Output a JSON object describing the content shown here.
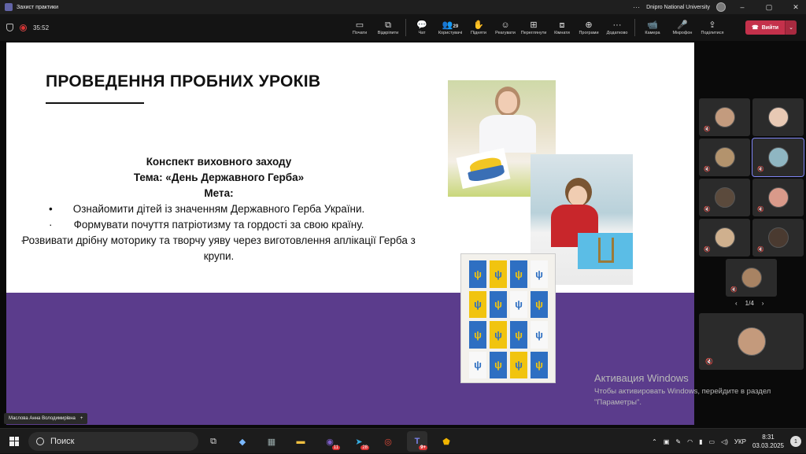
{
  "window": {
    "title": "Захист практики",
    "organization": "Dnipro National University",
    "more": "···",
    "minimize": "–",
    "maximize": "▢",
    "close": "✕"
  },
  "meeting": {
    "timer": "35:52",
    "participants_count": "29"
  },
  "toolbar": {
    "items": [
      {
        "label": "Почати",
        "icon": "▭"
      },
      {
        "label": "Відкріпити",
        "icon": "⧉"
      },
      {
        "label": "Чат",
        "icon": "💬"
      },
      {
        "label": "Користувачі",
        "icon": "👥"
      },
      {
        "label": "Підняти",
        "icon": "✋"
      },
      {
        "label": "Реагувати",
        "icon": "☺"
      },
      {
        "label": "Переглянути",
        "icon": "⊞"
      },
      {
        "label": "Кімнати",
        "icon": "⧈"
      },
      {
        "label": "Програми",
        "icon": "⊕"
      },
      {
        "label": "Додатково",
        "icon": "···"
      },
      {
        "label": "Камера",
        "icon": "📹"
      },
      {
        "label": "Мікрофон",
        "icon": "🎤"
      },
      {
        "label": "Поділитися",
        "icon": "⇪"
      }
    ],
    "leave_label": "Вийти",
    "leave_caret": "⌄"
  },
  "slide": {
    "title": "ПРОВЕДЕННЯ ПРОБНИХ УРОКІВ",
    "heading1": "Конспект виховного заходу",
    "heading2": "Тема: «День Державного Герба»",
    "heading3": "Мета:",
    "bullets": [
      "Ознайомити дітей із значенням Державного Герба України.",
      "Формувати почуття патріотизму та гордості за свою країну.",
      "Розвивати дрібну моторику та творчу уяву через виготовлення аплікації Герба з крупи."
    ],
    "colors": {
      "band": "#5b3c8c",
      "background": "#ffffff"
    }
  },
  "watermark": {
    "line1": "Активация Windows",
    "line2": "Чтобы активировать Windows, перейдите в раздел \"Параметры\"."
  },
  "speaker": {
    "name": "Маслова Анна Володимирівна",
    "plus": "+"
  },
  "gallery": {
    "pager": "1/4",
    "prev": "‹",
    "next": "›"
  },
  "taskbar": {
    "search_placeholder": "Поиск",
    "apps": [
      {
        "name": "task-view",
        "glyph": "⧉",
        "badge": ""
      },
      {
        "name": "copilot",
        "glyph": "◆",
        "badge": ""
      },
      {
        "name": "calculator",
        "glyph": "▦",
        "badge": ""
      },
      {
        "name": "file-explorer",
        "glyph": "▬",
        "badge": ""
      },
      {
        "name": "viber",
        "glyph": "◉",
        "badge": "11"
      },
      {
        "name": "telegram",
        "glyph": "➤",
        "badge": "28"
      },
      {
        "name": "chrome",
        "glyph": "◎",
        "badge": ""
      },
      {
        "name": "teams",
        "glyph": "T",
        "badge": "9+"
      },
      {
        "name": "app-pentagon",
        "glyph": "⬟",
        "badge": ""
      }
    ],
    "language": "УКР",
    "time": "8:31",
    "date": "03.03.2025",
    "notifications": "1"
  }
}
